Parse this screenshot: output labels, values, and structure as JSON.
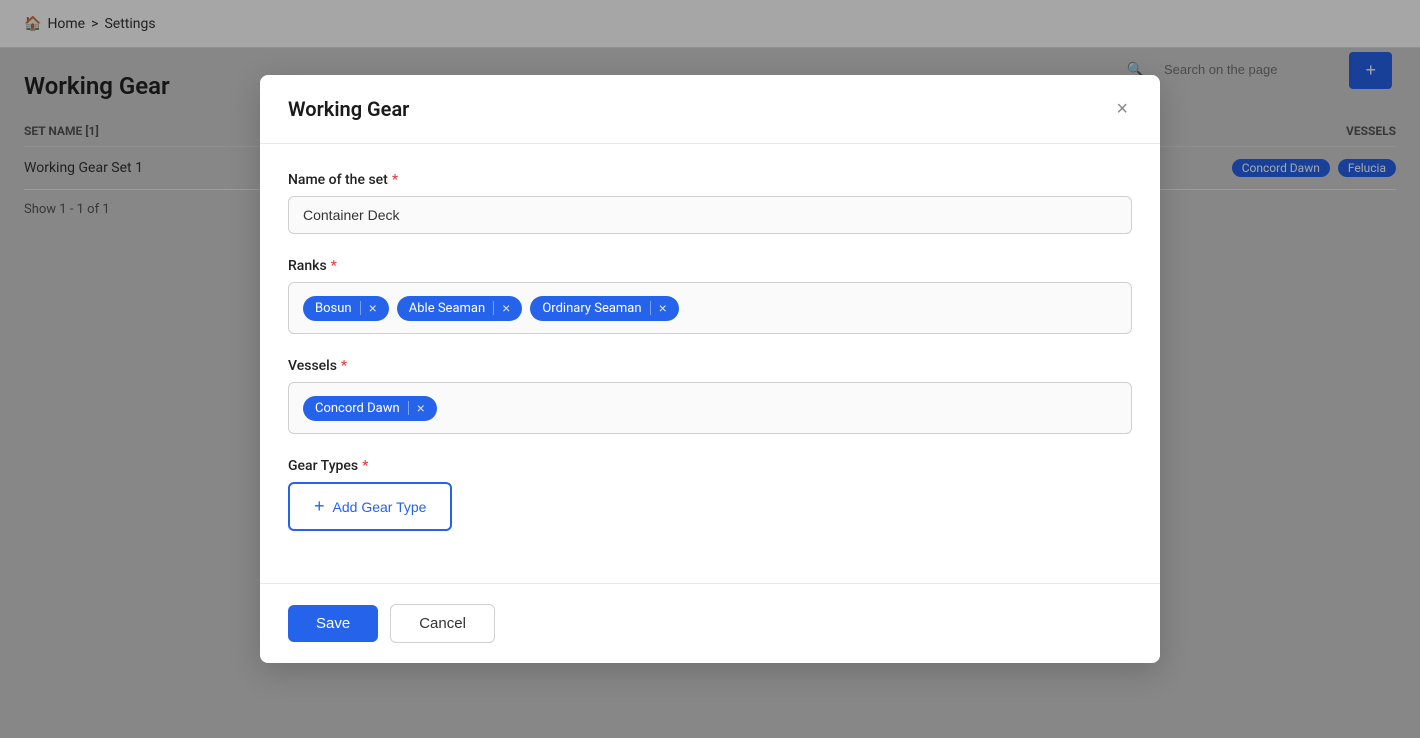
{
  "background": {
    "breadcrumb": {
      "home_label": "Home",
      "separator": ">",
      "settings_label": "Settings"
    },
    "page_title": "Working Gear",
    "table": {
      "headers": {
        "set_name": "SET NAME [1]",
        "vessels": "VESSELS"
      },
      "rows": [
        {
          "set_name": "Working Gear Set 1",
          "vessels": [
            "Concord Dawn",
            "Felucia"
          ]
        }
      ],
      "pagination": "Show 1 - 1 of 1"
    },
    "search_placeholder": "Search on the page",
    "add_button_label": "+"
  },
  "modal": {
    "title": "Working Gear",
    "close_label": "×",
    "fields": {
      "name_label": "Name of the set",
      "name_required": true,
      "name_value": "Container Deck",
      "ranks_label": "Ranks",
      "ranks_required": true,
      "ranks": [
        {
          "label": "Bosun"
        },
        {
          "label": "Able Seaman"
        },
        {
          "label": "Ordinary Seaman"
        }
      ],
      "vessels_label": "Vessels",
      "vessels_required": true,
      "vessels": [
        {
          "label": "Concord Dawn"
        }
      ],
      "gear_types_label": "Gear Types",
      "gear_types_required": true,
      "add_gear_type_label": "Add Gear Type"
    },
    "footer": {
      "save_label": "Save",
      "cancel_label": "Cancel"
    }
  }
}
